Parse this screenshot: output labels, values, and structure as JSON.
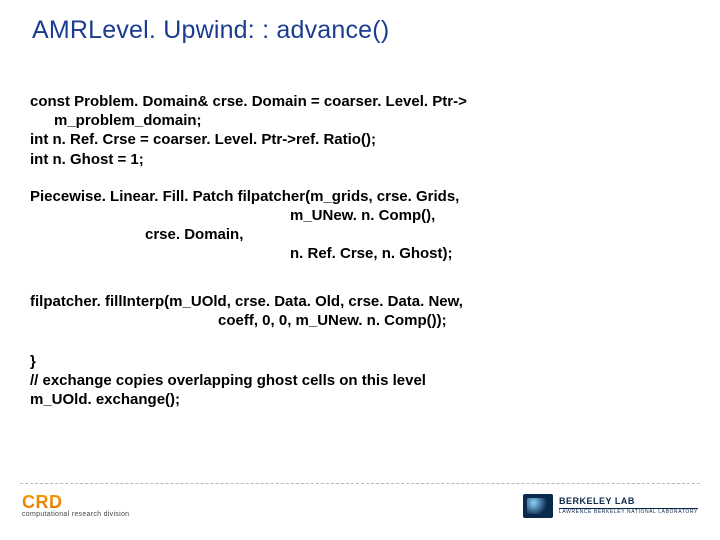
{
  "title": "AMRLevel. Upwind: : advance()",
  "code": {
    "l1": "const Problem. Domain& crse. Domain = coarser. Level. Ptr->",
    "l2": "m_problem_domain;",
    "l3": "int n. Ref. Crse = coarser. Level. Ptr->ref. Ratio();",
    "l4": "int n. Ghost = 1;",
    "l5": "Piecewise. Linear. Fill. Patch filpatcher(m_grids, crse. Grids,",
    "l6": "m_UNew. n. Comp(),",
    "l7": "crse. Domain,",
    "l8": "n. Ref. Crse, n. Ghost);",
    "l9": "filpatcher. fillInterp(m_UOld, crse. Data. Old, crse. Data. New,",
    "l10": "coeff, 0, 0, m_UNew. n. Comp());",
    "l11": "   }",
    "l12": " // exchange copies overlapping ghost cells on this level",
    "l13": "   m_UOld. exchange();"
  },
  "footer": {
    "left_main": "CRD",
    "left_sub": "computational research division",
    "right_main": "BERKELEY LAB",
    "right_sub": "LAWRENCE BERKELEY NATIONAL LABORATORY"
  }
}
